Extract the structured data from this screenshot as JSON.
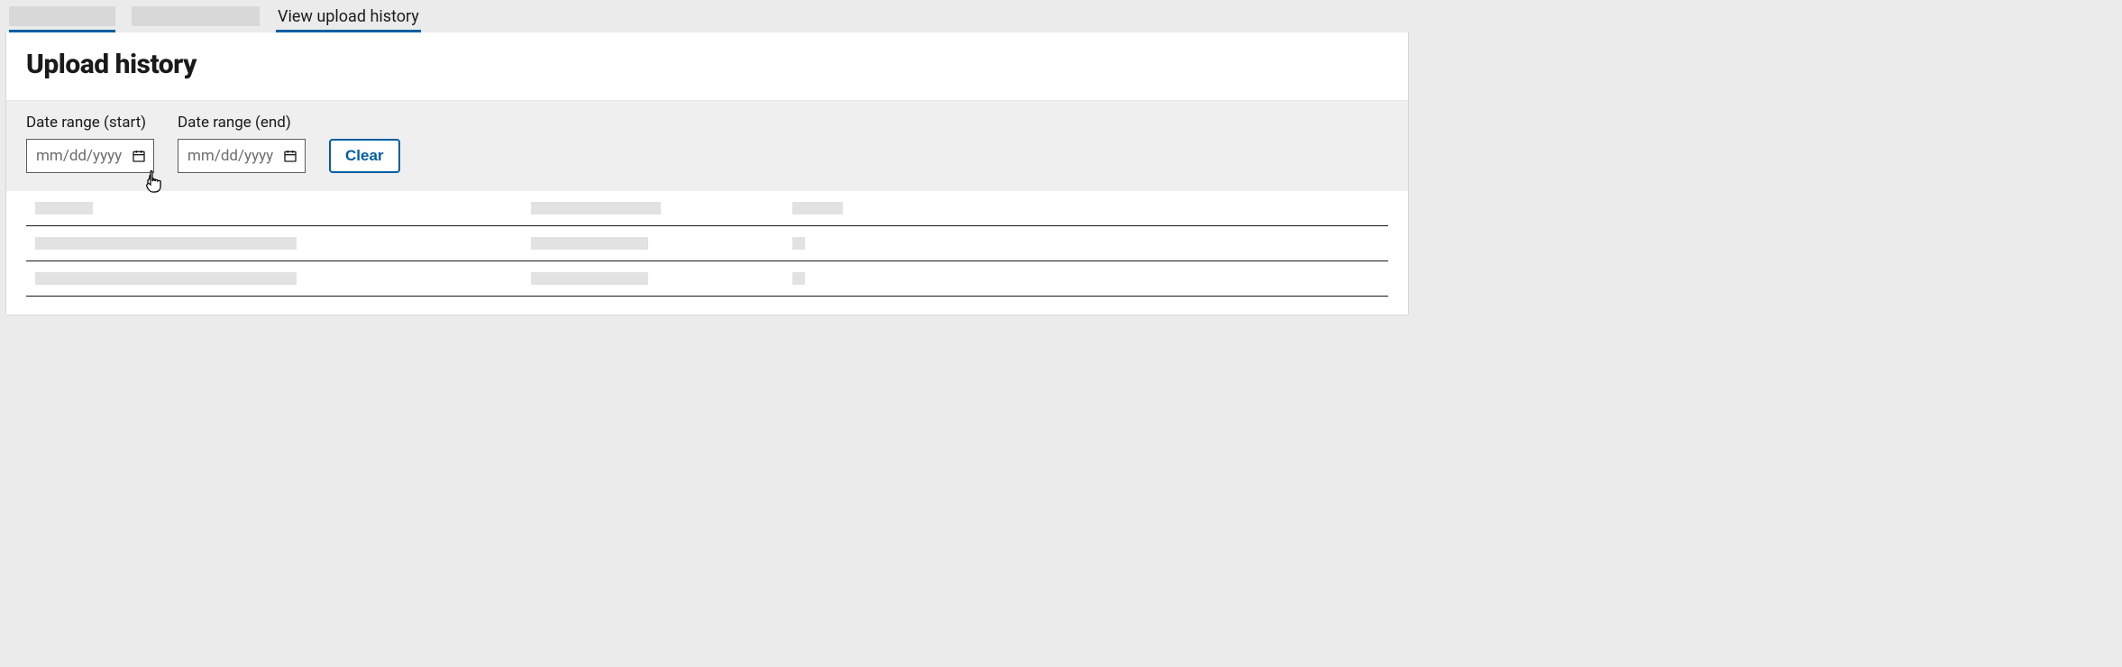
{
  "tabs": {
    "items": [
      {
        "label": ""
      },
      {
        "label": ""
      },
      {
        "label": "View upload history"
      }
    ]
  },
  "page": {
    "title": "Upload history"
  },
  "filters": {
    "start_label": "Date range (start)",
    "end_label": "Date range (end)",
    "start_placeholder": "mm/dd/yyyy",
    "end_placeholder": "mm/dd/yyyy",
    "clear_label": "Clear"
  }
}
